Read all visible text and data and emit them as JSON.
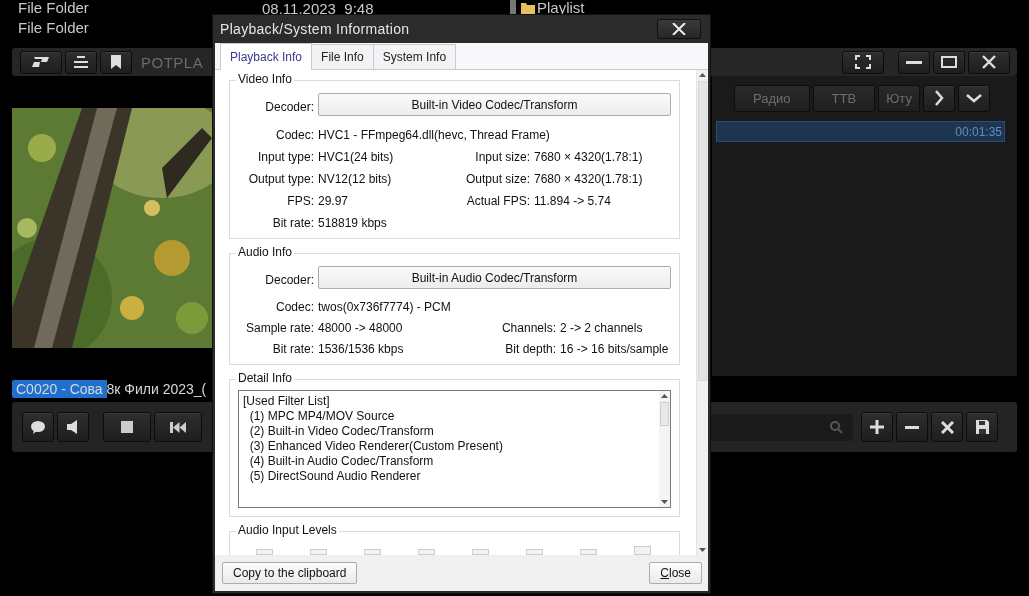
{
  "desktop": {
    "rows": [
      {
        "name": "File Folder",
        "date": "08.11.2023  9:48"
      },
      {
        "name": "File Folder"
      }
    ],
    "playlist_folder": "Playlist"
  },
  "player": {
    "title": "POTPLA",
    "playlist_tabs": [
      {
        "label": "Радио",
        "selected": false
      },
      {
        "label": "ТТВ",
        "selected": false
      },
      {
        "label": "Юту",
        "selected": false
      }
    ],
    "playlist_rows": [
      {
        "duration": "00:01:35",
        "selected": true
      }
    ],
    "file_tab": "C0020 - Сова 8к Фили 2023_("
  },
  "dialog": {
    "title": "Playback/System Information",
    "tabs": [
      {
        "label": "Playback Info",
        "selected": true
      },
      {
        "label": "File Info",
        "selected": false
      },
      {
        "label": "System Info",
        "selected": false
      }
    ],
    "video_info": {
      "title": "Video Info",
      "decoder_label": "Decoder:",
      "decoder": "Built-in Video Codec/Transform",
      "fields": [
        {
          "label": "Codec:",
          "value": "HVC1 - FFmpeg64.dll(hevc, Thread Frame)",
          "kind": "wide"
        },
        {
          "label": "Input type:",
          "value": "HVC1(24 bits)",
          "kind": "left"
        },
        {
          "label": "Input size:",
          "value": "7680 × 4320(1.78:1)",
          "kind": "right"
        },
        {
          "label": "Output type:",
          "value": "NV12(12 bits)",
          "kind": "left"
        },
        {
          "label": "Output size:",
          "value": "7680 × 4320(1.78:1)",
          "kind": "right"
        },
        {
          "label": "FPS:",
          "value": "29.97",
          "kind": "left"
        },
        {
          "label": "Actual FPS:",
          "value": "11.894 -> 5.74",
          "kind": "right"
        },
        {
          "label": "Bit rate:",
          "value": "518819 kbps",
          "kind": "left"
        }
      ]
    },
    "audio_info": {
      "title": "Audio Info",
      "decoder_label": "Decoder:",
      "decoder": "Built-in Audio Codec/Transform",
      "fields": [
        {
          "label": "Codec:",
          "value": "twos(0x736f7774) - PCM",
          "kind": "wide"
        },
        {
          "label": "Sample rate:",
          "value": "48000 -> 48000",
          "kind": "left"
        },
        {
          "label": "Channels:",
          "value": "2 -> 2 channels",
          "kind": "right"
        },
        {
          "label": "Bit rate:",
          "value": "1536/1536 kbps",
          "kind": "left"
        },
        {
          "label": "Bit depth:",
          "value": "16 -> 16 bits/sample",
          "kind": "right"
        }
      ]
    },
    "detail_info": {
      "title": "Detail Info",
      "lines": [
        "[Used Filter List]",
        "  (1) MPC MP4/MOV Source",
        "  (2) Built-in Video Codec/Transform",
        "  (3) Enhanced Video Renderer(Custom Present)",
        "  (4) Built-in Audio Codec/Transform",
        "  (5) DirectSound Audio Renderer"
      ]
    },
    "audio_levels": {
      "title": "Audio Input Levels"
    },
    "copy_button": "Copy to the clipboard",
    "close_button": "Close"
  }
}
